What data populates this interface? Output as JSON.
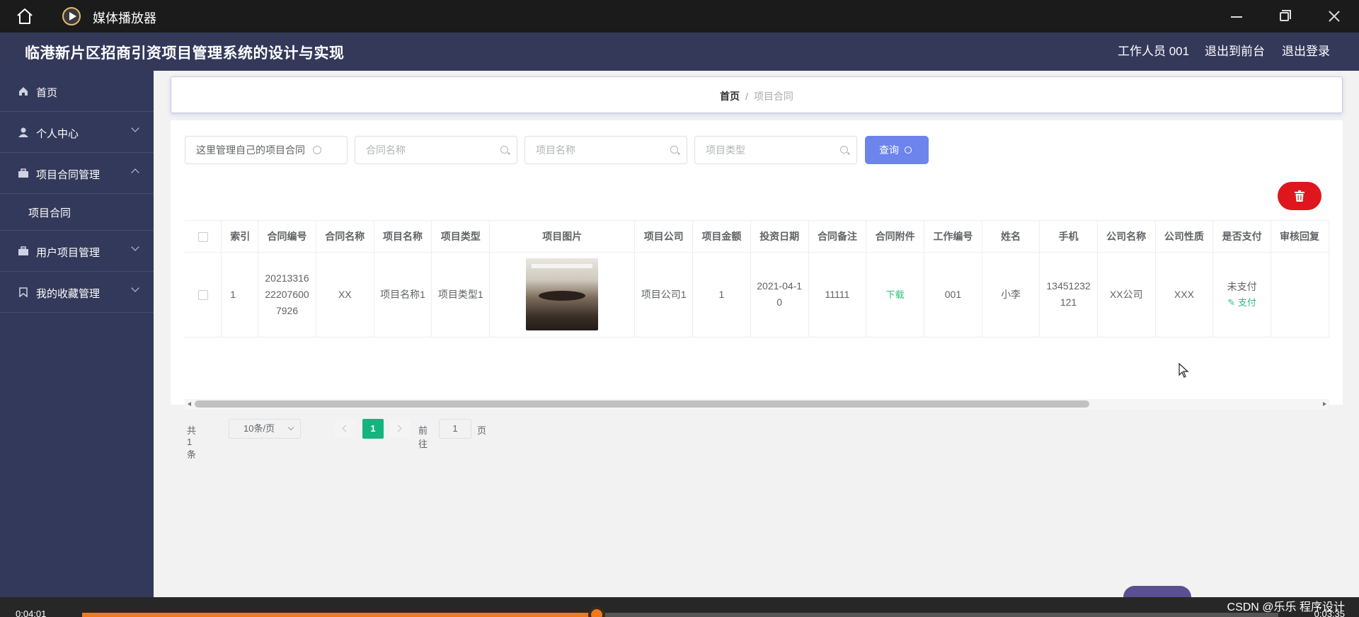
{
  "player": {
    "title": "媒体播放器",
    "time_current": "0:04:01",
    "time_total": "0:03:35",
    "progress": 0.43,
    "watermark": "CSDN @乐乐 程序设计"
  },
  "header": {
    "title": "临港新片区招商引资项目管理系统的设计与实现",
    "user": "工作人员 001",
    "to_front": "退出到前台",
    "logout": "退出登录"
  },
  "sidebar": {
    "home": "首页",
    "personal": "个人中心",
    "contract_mgmt": "项目合同管理",
    "contract_sub": "项目合同",
    "user_project_mgmt": "用户项目管理",
    "favorites_mgmt": "我的收藏管理"
  },
  "breadcrumb": {
    "home": "首页",
    "sep": "/",
    "current": "项目合同"
  },
  "search": {
    "scope_value": "这里管理自己的项目合同",
    "contract_name_placeholder": "合同名称",
    "project_name_placeholder": "项目名称",
    "project_type_placeholder": "项目类型",
    "query_label": "查询"
  },
  "table": {
    "columns": {
      "index": "索引",
      "contract_no": "合同编号",
      "contract_name": "合同名称",
      "project_name": "项目名称",
      "project_type": "项目类型",
      "project_image": "项目图片",
      "project_company": "项目公司",
      "project_amount": "项目金额",
      "invest_date": "投资日期",
      "contract_note": "合同备注",
      "contract_attachment": "合同附件",
      "work_no": "工作编号",
      "name": "姓名",
      "phone": "手机",
      "company_name": "公司名称",
      "company_nature": "公司性质",
      "is_paid": "是否支付",
      "review_reply": "审核回复"
    },
    "rows": [
      {
        "index": "1",
        "contract_no": "20213316222076007926",
        "contract_name": "XX",
        "project_name": "项目名称1",
        "project_type": "项目类型1",
        "project_company": "项目公司1",
        "project_amount": "1",
        "invest_date": "2021-04-10",
        "contract_note": "11111",
        "contract_attachment": "下载",
        "work_no": "001",
        "name": "小李",
        "phone": "13451232121",
        "company_name": "XX公司",
        "company_nature": "XXX",
        "is_paid": "未支付",
        "pay_action": "支付",
        "review_reply": ""
      }
    ]
  },
  "pagination": {
    "total": "共 1 条",
    "page_size": "10条/页",
    "current_page": "1",
    "goto_label": "前往",
    "goto_value": "1",
    "page_suffix": "页"
  },
  "colors": {
    "sidebar_bg": "#33395a",
    "query_button": "#6c84ec",
    "delete_button": "#e0161e",
    "active_page": "#15b47f",
    "accent_green": "#2fbd7d"
  }
}
